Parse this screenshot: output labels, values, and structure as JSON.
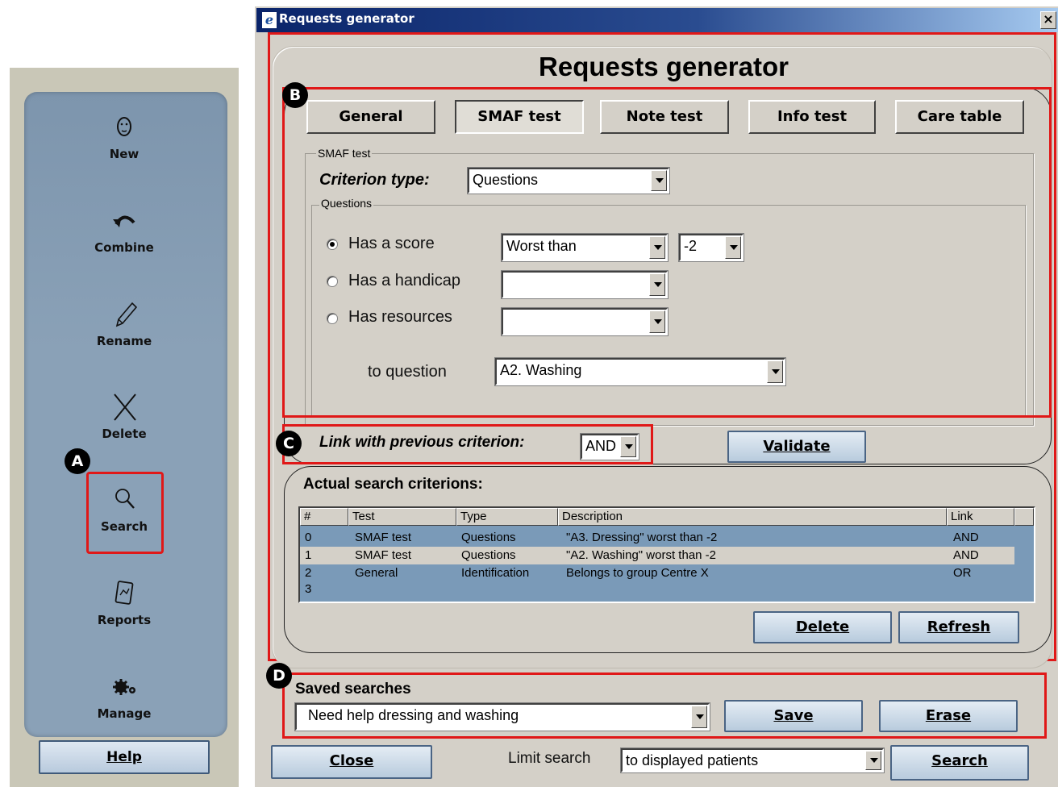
{
  "sidebar": {
    "items": [
      {
        "label": "New",
        "icon": "face-icon"
      },
      {
        "label": "Combine",
        "icon": "undo-arrow-icon"
      },
      {
        "label": "Rename",
        "icon": "pencil-icon"
      },
      {
        "label": "Delete",
        "icon": "x-icon"
      },
      {
        "label": "Search",
        "icon": "magnifier-icon"
      },
      {
        "label": "Reports",
        "icon": "reports-icon"
      },
      {
        "label": "Manage",
        "icon": "gears-icon"
      }
    ],
    "help_label": "Help",
    "highlight_badge": "A"
  },
  "window": {
    "title": "Requests generator",
    "heading": "Requests generator",
    "close_glyph": "×"
  },
  "tabs": [
    {
      "label": "General",
      "active": false
    },
    {
      "label": "SMAF test",
      "active": true
    },
    {
      "label": "Note test",
      "active": false
    },
    {
      "label": "Info test",
      "active": false
    },
    {
      "label": "Care table",
      "active": false
    }
  ],
  "smaf": {
    "group_title": "SMAF test",
    "criterion_type_label": "Criterion type:",
    "criterion_type_value": "Questions",
    "questions_group_title": "Questions",
    "score_label": "Has a score",
    "score_comparator": "Worst than",
    "score_value": "-2",
    "handicap_label": "Has a handicap",
    "handicap_value": "",
    "resources_label": "Has resources",
    "resources_value": "",
    "to_question_label": "to question",
    "to_question_value": "A2. Washing",
    "selected_option": "score"
  },
  "link": {
    "label": "Link with previous criterion:",
    "value": "AND",
    "validate_label": "Validate"
  },
  "actual": {
    "title": "Actual search criterions:",
    "columns": [
      "#",
      "Test",
      "Type",
      "Description",
      "Link"
    ],
    "rows": [
      {
        "num": "0",
        "test": "SMAF test",
        "type": "Questions",
        "description": "\"A3. Dressing\" worst than -2",
        "link": "AND"
      },
      {
        "num": "1",
        "test": "SMAF test",
        "type": "Questions",
        "description": "\"A2. Washing\" worst than -2",
        "link": "AND"
      },
      {
        "num": "2",
        "test": "General",
        "type": "Identification",
        "description": "Belongs to group Centre X",
        "link": "OR"
      },
      {
        "num": "3",
        "test": "",
        "type": "",
        "description": "",
        "link": ""
      }
    ],
    "selected_row": 1,
    "delete_label": "Delete",
    "refresh_label": "Refresh"
  },
  "saved": {
    "title": "Saved searches",
    "value": "Need help dressing and washing",
    "save_label": "Save",
    "erase_label": "Erase"
  },
  "footer": {
    "close_label": "Close",
    "limit_label": "Limit search",
    "limit_value": "to displayed patients",
    "search_label": "Search"
  },
  "badges": {
    "b": "B",
    "c": "C",
    "d": "D"
  },
  "colors": {
    "highlight": "#e01818",
    "table_bg": "#7a9ab8",
    "sidebar_bg": "#8aa1b7"
  }
}
